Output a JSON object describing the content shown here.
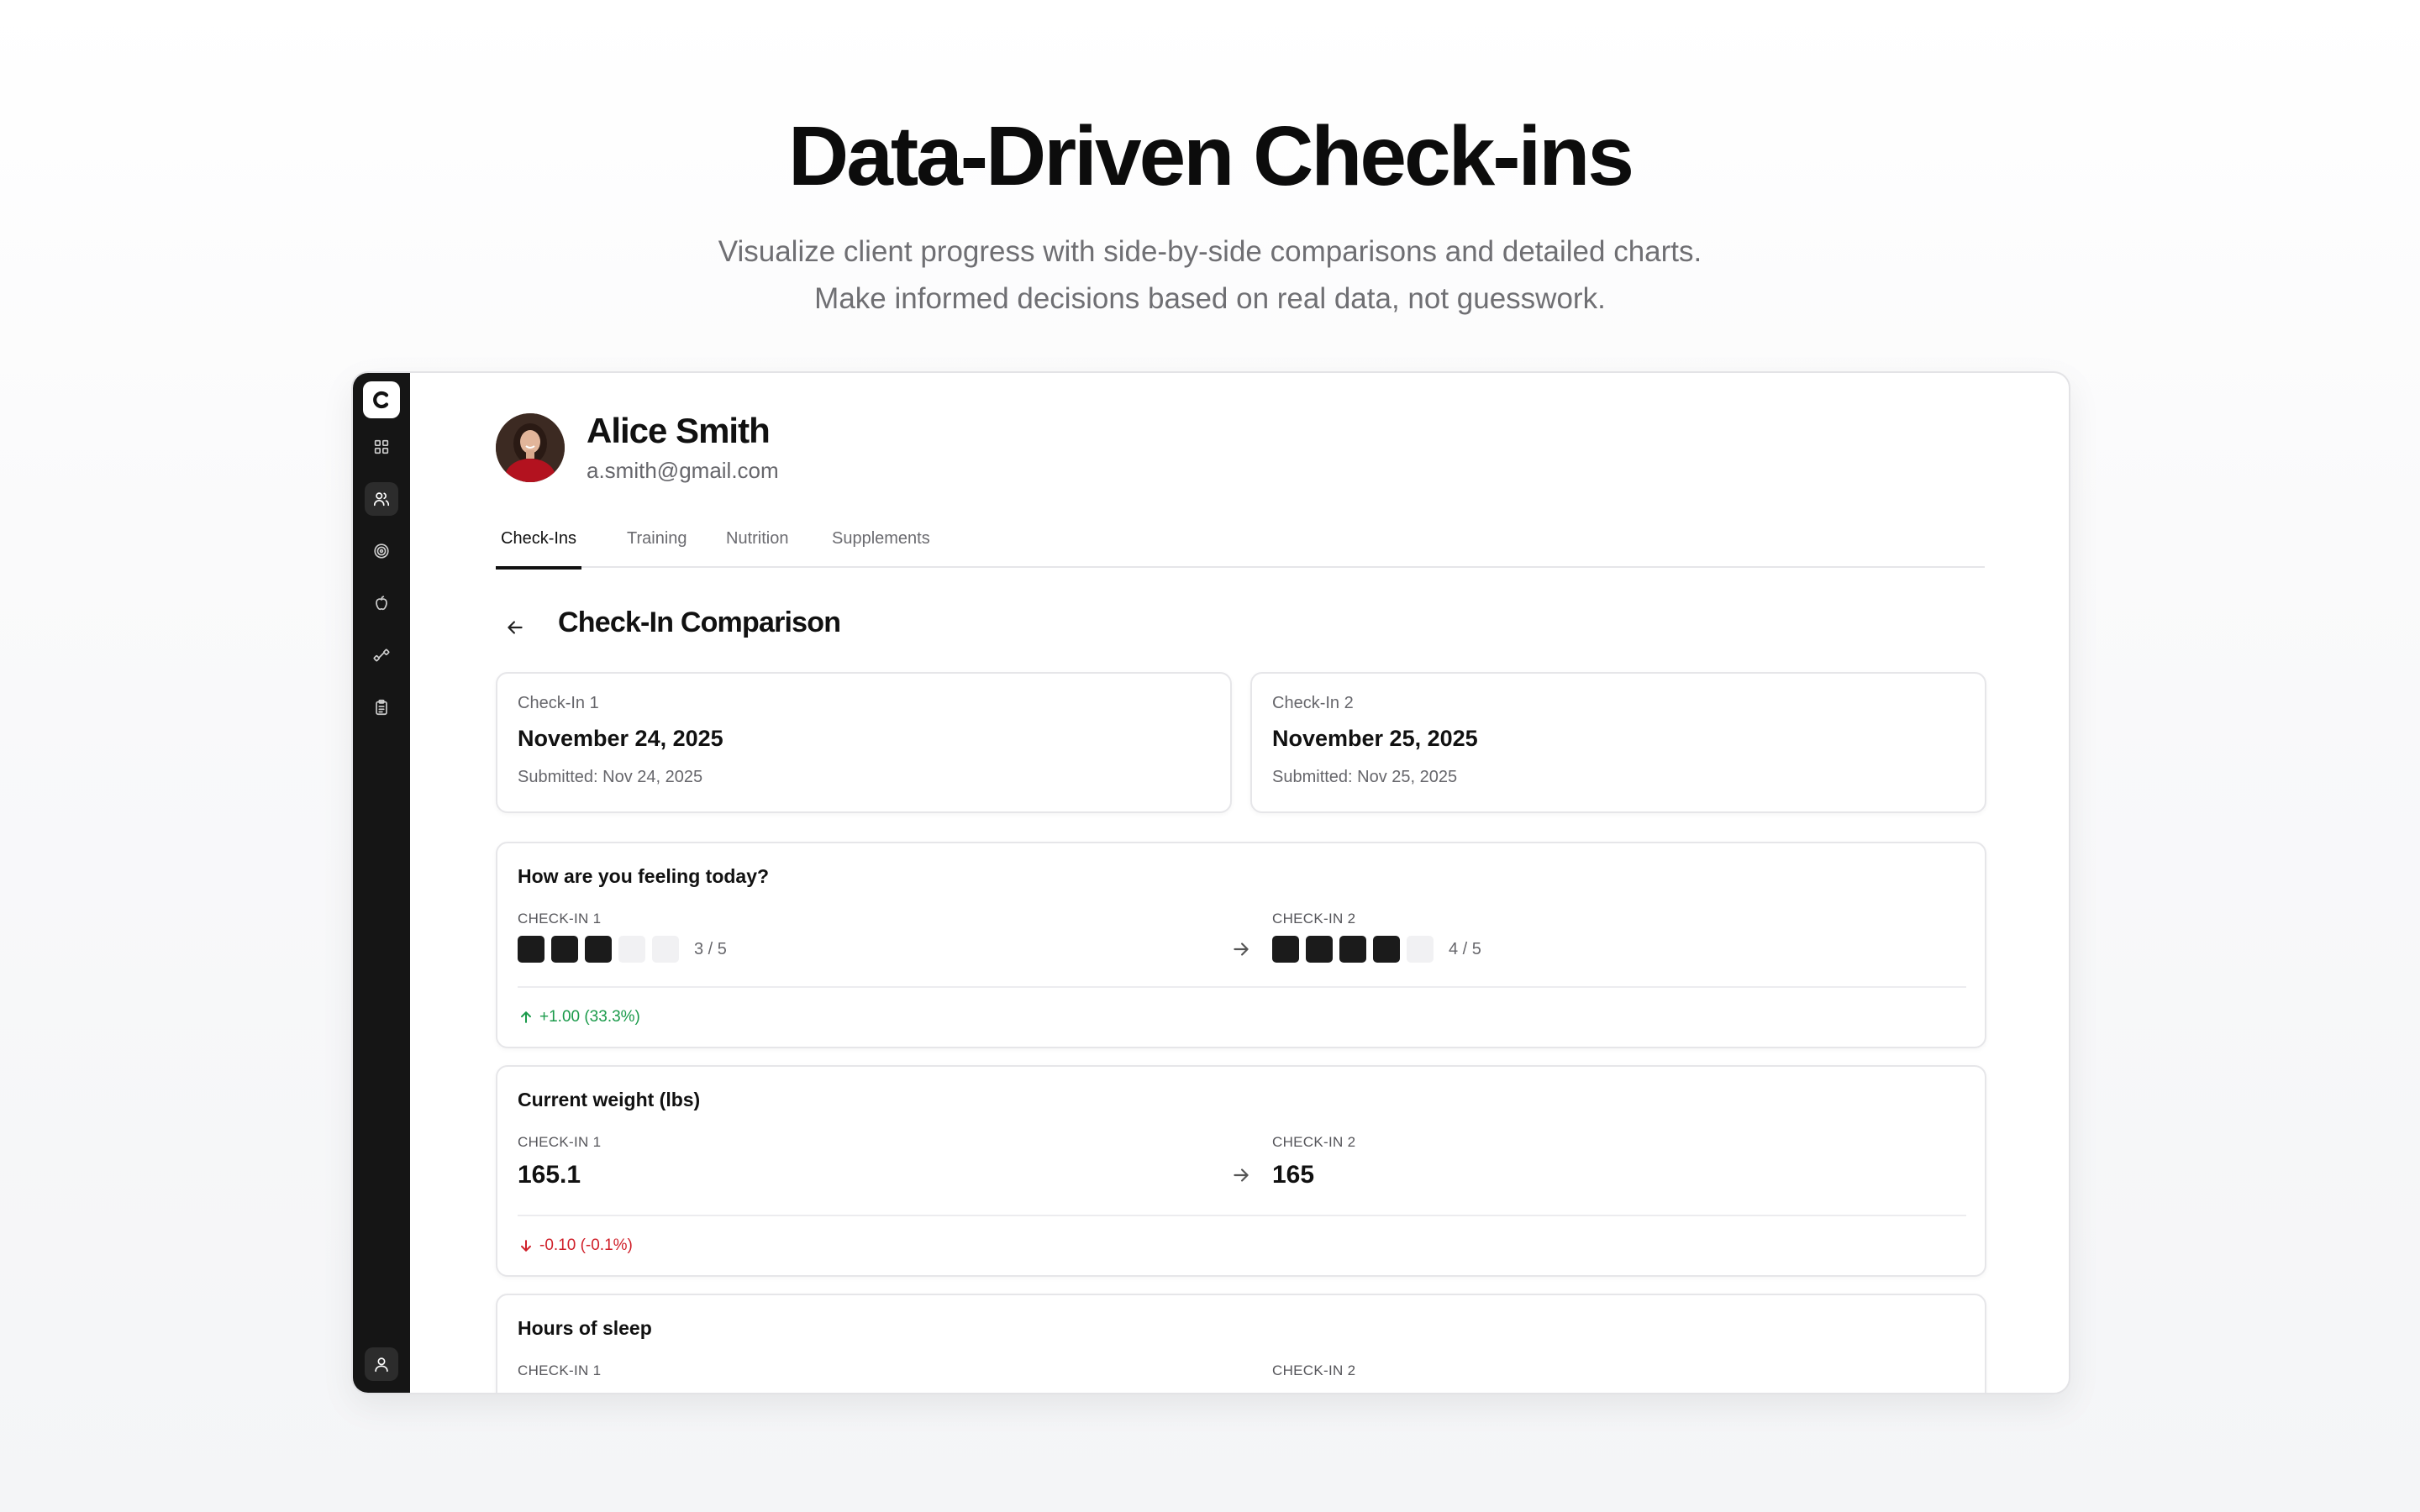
{
  "hero": {
    "title": "Data-Driven Check-ins",
    "subtitle_line1": "Visualize client progress with side-by-side comparisons and detailed charts.",
    "subtitle_line2": "Make informed decisions based on real data, not guesswork."
  },
  "sidebar": {
    "logo": "C",
    "items": [
      {
        "icon": "dashboard-grid-icon",
        "active": false
      },
      {
        "icon": "users-icon",
        "active": true
      },
      {
        "icon": "target-icon",
        "active": false
      },
      {
        "icon": "apple-icon",
        "active": false
      },
      {
        "icon": "dumbbell-icon",
        "active": false
      },
      {
        "icon": "clipboard-icon",
        "active": false
      }
    ],
    "bottom_icon": "user-profile-icon"
  },
  "client": {
    "name": "Alice Smith",
    "email": "a.smith@gmail.com"
  },
  "tabs": [
    "Check-Ins",
    "Training",
    "Nutrition",
    "Supplements"
  ],
  "active_tab": "Check-Ins",
  "section_title": "Check-In Comparison",
  "checkins": [
    {
      "label": "Check-In 1",
      "date": "November 24, 2025",
      "submitted": "Submitted: Nov 24, 2025"
    },
    {
      "label": "Check-In 2",
      "date": "November 25, 2025",
      "submitted": "Submitted: Nov 25, 2025"
    }
  ],
  "questions": [
    {
      "title": "How are you feeling today?",
      "type": "rating",
      "col1_label": "CHECK-IN 1",
      "col2_label": "CHECK-IN 2",
      "value1": 3,
      "value2": 4,
      "max": 5,
      "value1_text": "3 / 5",
      "value2_text": "4 / 5",
      "delta": "+1.00 (33.3%)",
      "delta_direction": "up"
    },
    {
      "title": "Current weight (lbs)",
      "type": "number",
      "col1_label": "CHECK-IN 1",
      "col2_label": "CHECK-IN 2",
      "value1": "165.1",
      "value2": "165",
      "delta": "-0.10 (-0.1%)",
      "delta_direction": "down"
    },
    {
      "title": "Hours of sleep",
      "type": "number",
      "col1_label": "CHECK-IN 1",
      "col2_label": "CHECK-IN 2"
    }
  ],
  "colors": {
    "sidebar_bg": "#151515",
    "positive": "#1a9a4a",
    "negative": "#d0202a",
    "rating_filled": "#1b1b1b",
    "rating_empty": "#f1f1f3"
  }
}
